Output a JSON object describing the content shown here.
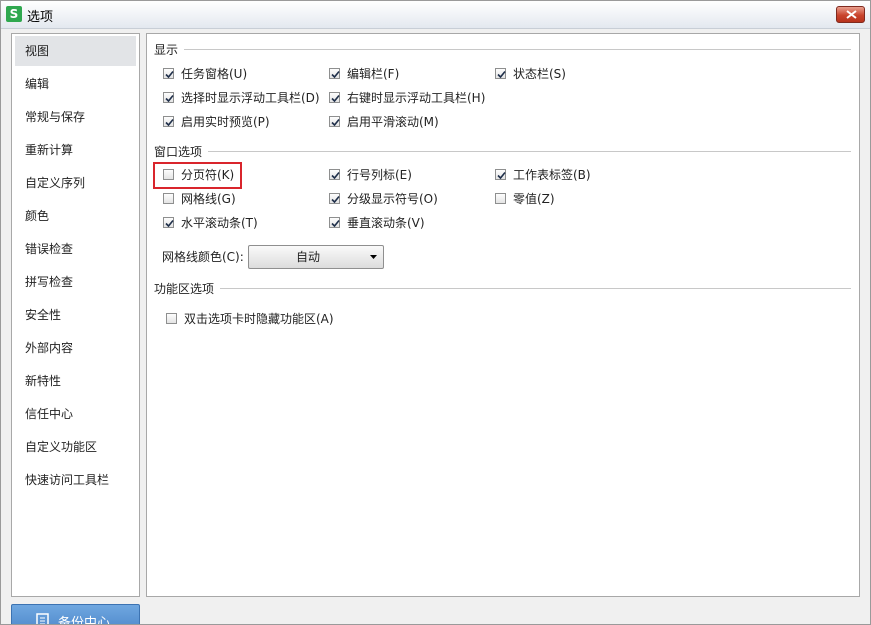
{
  "window": {
    "title": "选项",
    "app_icon_letter": "S"
  },
  "sidebar": {
    "items": [
      {
        "label": "视图",
        "selected": true
      },
      {
        "label": "编辑"
      },
      {
        "label": "常规与保存"
      },
      {
        "label": "重新计算"
      },
      {
        "label": "自定义序列"
      },
      {
        "label": "颜色"
      },
      {
        "label": "错误检查"
      },
      {
        "label": "拼写检查"
      },
      {
        "label": "安全性"
      },
      {
        "label": "外部内容"
      },
      {
        "label": "新特性"
      },
      {
        "label": "信任中心"
      },
      {
        "label": "自定义功能区"
      },
      {
        "label": "快速访问工具栏"
      }
    ],
    "backup_label": "备份中心"
  },
  "display": {
    "title": "显示",
    "options": [
      {
        "label": "任务窗格(U)",
        "checked": true
      },
      {
        "label": "编辑栏(F)",
        "checked": true
      },
      {
        "label": "状态栏(S)",
        "checked": true
      },
      {
        "label": "选择时显示浮动工具栏(D)",
        "checked": true
      },
      {
        "label": "右键时显示浮动工具栏(H)",
        "checked": true
      },
      {
        "label": "启用实时预览(P)",
        "checked": true
      },
      {
        "label": "启用平滑滚动(M)",
        "checked": true
      }
    ]
  },
  "window_options": {
    "title": "窗口选项",
    "options": [
      {
        "label": "分页符(K)",
        "checked": false
      },
      {
        "label": "行号列标(E)",
        "checked": true
      },
      {
        "label": "工作表标签(B)",
        "checked": true
      },
      {
        "label": "网格线(G)",
        "checked": false
      },
      {
        "label": "分级显示符号(O)",
        "checked": true
      },
      {
        "label": "零值(Z)",
        "checked": false
      },
      {
        "label": "水平滚动条(T)",
        "checked": true
      },
      {
        "label": "垂直滚动条(V)",
        "checked": true
      }
    ],
    "gridline_color_label": "网格线颜色(C):",
    "gridline_color_value": "自动"
  },
  "ribbon": {
    "title": "功能区选项",
    "options": [
      {
        "label": "双击选项卡时隐藏功能区(A)",
        "checked": false
      }
    ]
  },
  "colors": {
    "highlight": "#d9252c",
    "app_icon": "#2fa84f",
    "backup_button": "#5a94d4"
  },
  "icons": {
    "check": "checkmark-icon",
    "close": "close-icon",
    "backup": "document-icon",
    "dropdown": "dropdown-arrow-icon"
  }
}
